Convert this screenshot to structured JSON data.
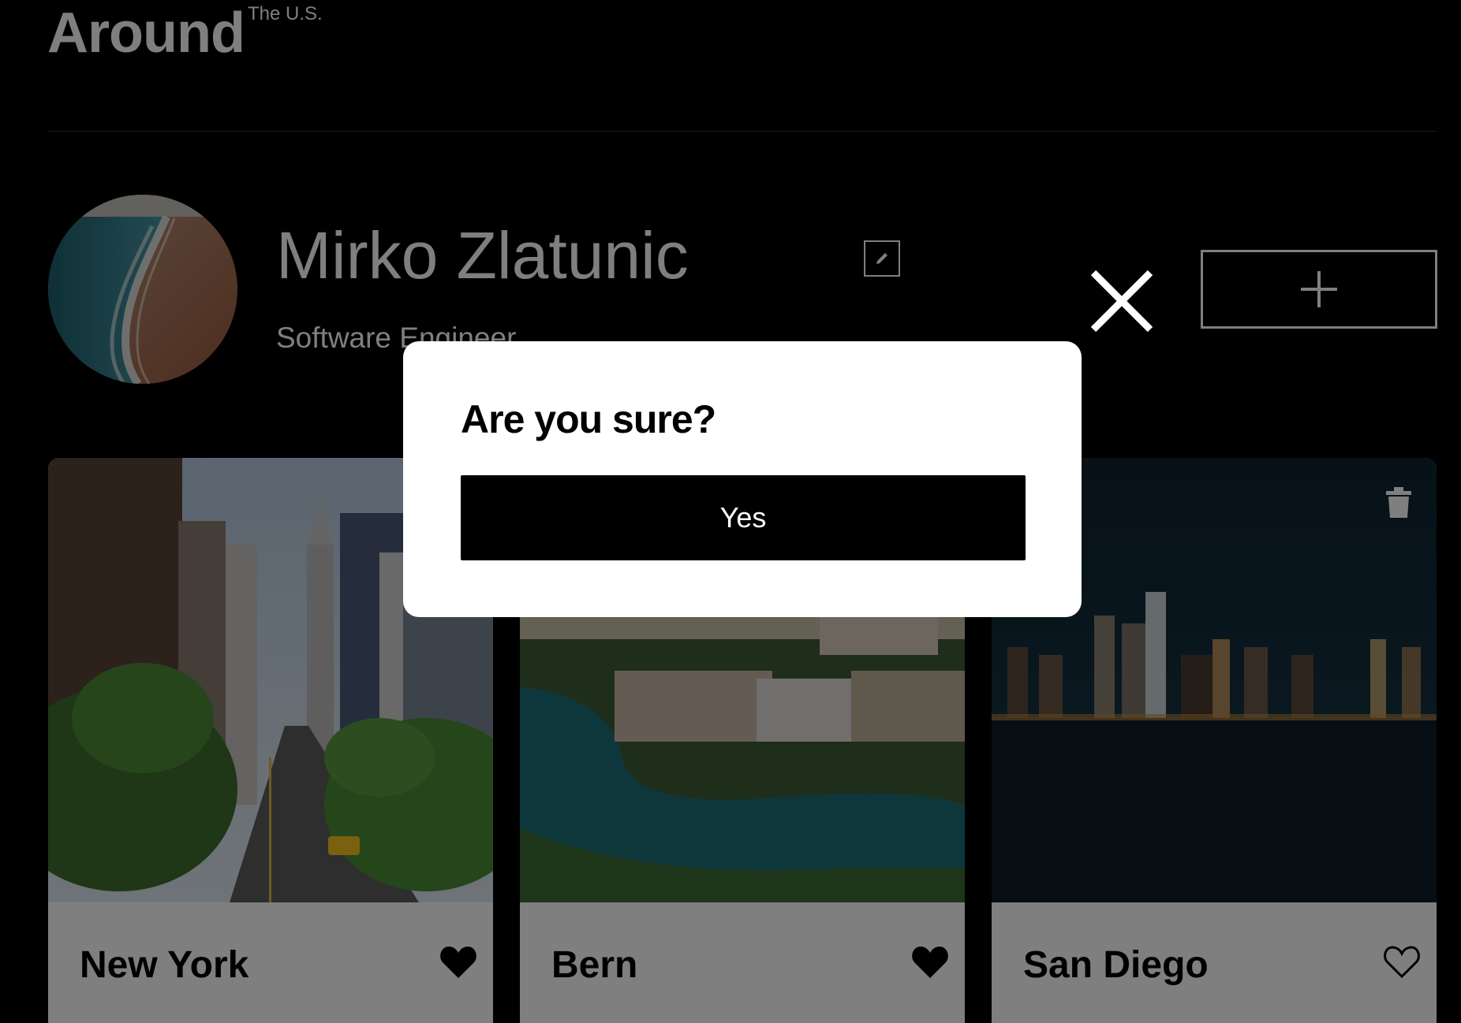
{
  "header": {
    "logo_text": "Around",
    "logo_superscript": "The U.S."
  },
  "profile": {
    "name": "Mirko Zlatunic",
    "about": "Software Engineer",
    "add_label": "+"
  },
  "cards": [
    {
      "title": "New York",
      "liked": true
    },
    {
      "title": "Bern",
      "liked": true
    },
    {
      "title": "San Diego",
      "liked": false
    }
  ],
  "modal": {
    "title": "Are you sure?",
    "confirm_label": "Yes"
  },
  "icons": {
    "edit": "pencil-icon",
    "add": "plus-icon",
    "close": "close-icon",
    "like": "heart-icon",
    "delete": "trash-icon"
  },
  "colors": {
    "background": "#000000",
    "card_background": "#ffffff",
    "text_dark": "#000000",
    "text_light": "#ffffff",
    "overlay": "rgba(0,0,0,0.5)"
  }
}
